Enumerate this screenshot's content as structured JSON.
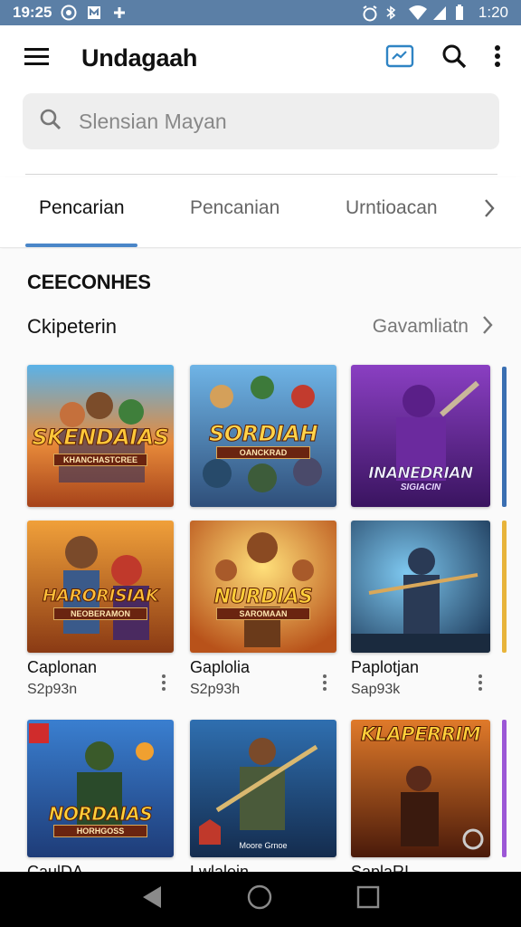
{
  "status_bar": {
    "time": "19:25",
    "right_time": "1:20",
    "icons_left": [
      "whatsapp-icon",
      "notification-box-icon",
      "puzzle-icon"
    ],
    "icons_right": [
      "alarm-icon",
      "bluetooth-icon",
      "wifi-icon",
      "signal-icon",
      "battery-icon"
    ]
  },
  "app_bar": {
    "title": "Undagaah",
    "icons": [
      "menu-icon",
      "trending-icon",
      "search-icon",
      "more-vert-icon"
    ]
  },
  "search": {
    "placeholder": "Slensian Mayan"
  },
  "tabs": [
    {
      "label": "Pencarian",
      "active": true
    },
    {
      "label": "Pencanian",
      "active": false
    },
    {
      "label": "Urntioacan",
      "active": false
    }
  ],
  "section": {
    "title": "CEECONHES",
    "subtitle": "Ckipeterin",
    "see_all": "Gavamliatn"
  },
  "tiles": [
    {
      "art_title": "SKENDAIAS",
      "art_subtitle": "KHANCHASTCREE",
      "accent": "#e0762a"
    },
    {
      "art_title": "SORDIAH",
      "art_subtitle": "OANCKRAD",
      "accent": "#3d7fc4"
    },
    {
      "art_title": "INANEDRIAN",
      "art_subtitle": "SIGIACIN",
      "accent": "#7a2db0"
    },
    {
      "art_title": "HARORISIAK",
      "art_subtitle": "NEOBERAMON",
      "accent": "#d9711e"
    },
    {
      "art_title": "NURDIAS",
      "art_subtitle": "SAROMAAN",
      "accent": "#e9a020"
    },
    {
      "art_title": "",
      "art_subtitle": "",
      "accent": "#2a5f8a"
    },
    {
      "art_title": "NORDAIAS",
      "art_subtitle": "HORHGOSS",
      "accent": "#2b6bb0"
    },
    {
      "art_title": "",
      "art_subtitle": "Moore Grnoe",
      "accent": "#1d4f7e"
    },
    {
      "art_title": "KLAPERRIM",
      "art_subtitle": "",
      "accent": "#c2501d"
    }
  ],
  "row2_captions": [
    {
      "name": "Caplonan",
      "sub": "S2p93n"
    },
    {
      "name": "Gaplolia",
      "sub": "S2p93h"
    },
    {
      "name": "Paplotjan",
      "sub": "Sap93k"
    }
  ],
  "row3_captions": [
    {
      "name": "CaulDA",
      "sub": ""
    },
    {
      "name": "Lwlalein",
      "sub": ""
    },
    {
      "name": "SaplaRI",
      "sub": ""
    }
  ],
  "nav_bar": {
    "icons": [
      "back-icon",
      "home-icon",
      "recents-icon"
    ]
  },
  "colors": {
    "status_bar": "#5b7fa6",
    "tab_indicator": "#4a86c8",
    "accent_icon": "#2f84c4"
  }
}
